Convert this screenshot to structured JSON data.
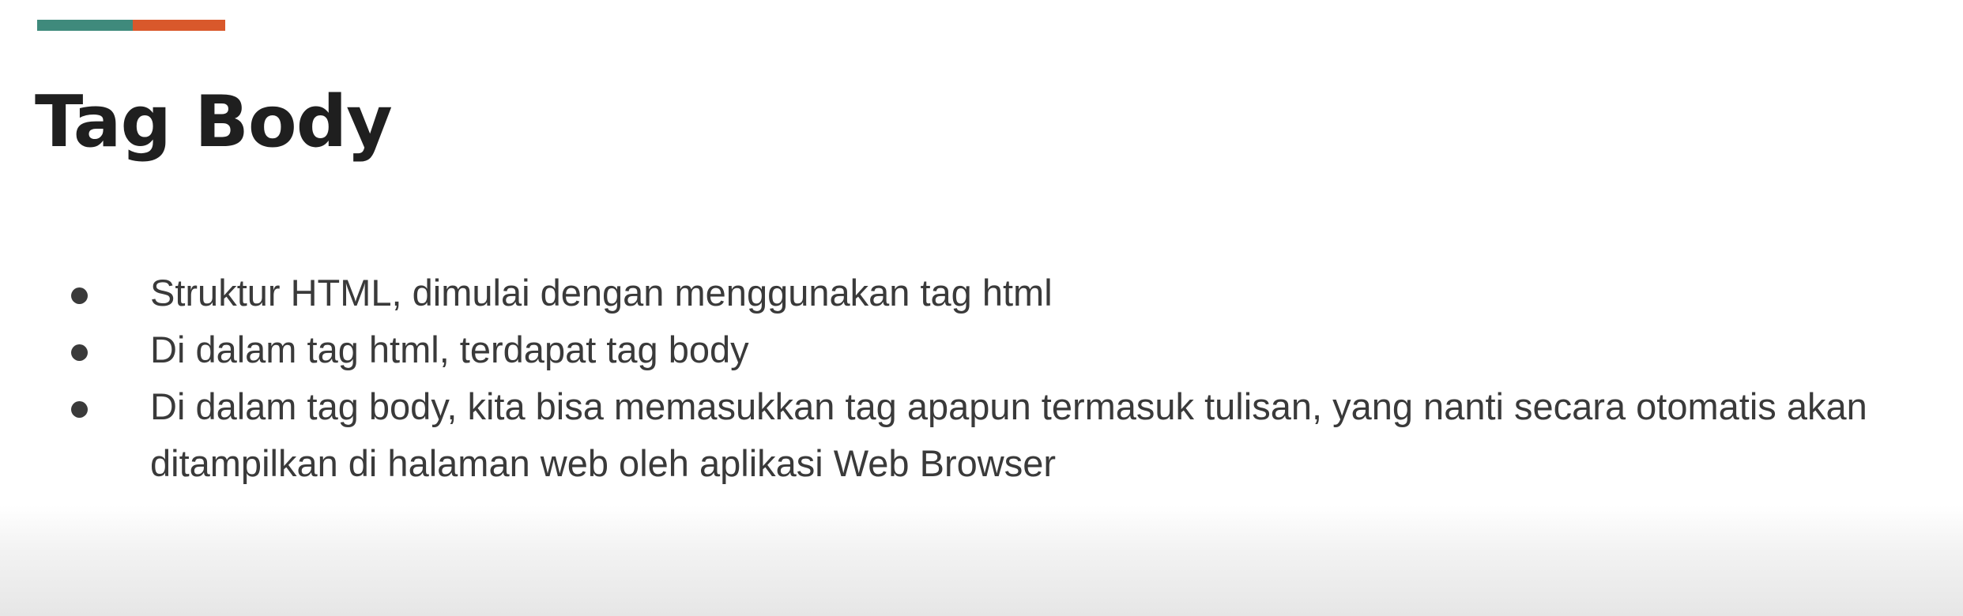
{
  "slide": {
    "title": "Tag Body",
    "accent_colors": [
      "#3f8a7c",
      "#d9582b"
    ],
    "bullets": [
      "Struktur HTML, dimulai dengan menggunakan tag html",
      "Di dalam tag html, terdapat tag body",
      "Di dalam tag body, kita bisa memasukkan tag apapun termasuk tulisan, yang nanti secara otomatis akan ditampilkan di halaman web oleh aplikasi Web Browser"
    ]
  }
}
